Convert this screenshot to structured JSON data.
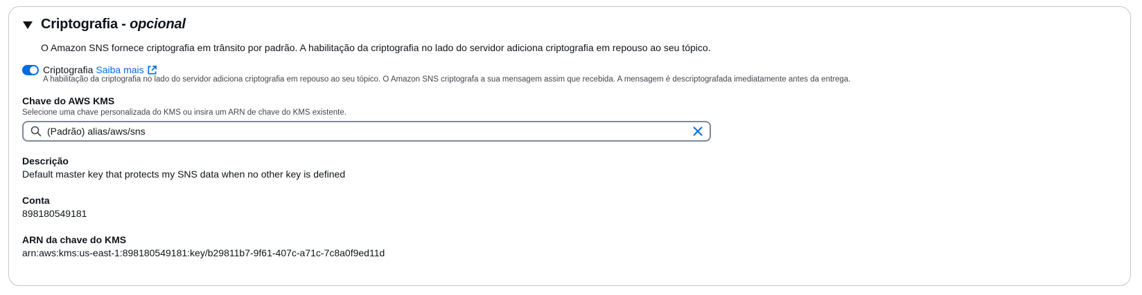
{
  "section": {
    "title": "Criptografia - ",
    "title_optional": "opcional",
    "description": "O Amazon SNS fornece criptografia em trânsito por padrão. A habilitação da criptografia no lado do servidor adiciona criptografia em repouso ao seu tópico."
  },
  "encryption_toggle": {
    "label": "Criptografia",
    "enabled": true,
    "learn_more": "Saiba mais",
    "description": "A habilitação da criptografia no lado do servidor adiciona criptografia em repouso ao seu tópico. O Amazon SNS criptografa a sua mensagem assim que recebida. A mensagem é descriptografada imediatamente antes da entrega."
  },
  "kms_key": {
    "label": "Chave do AWS KMS",
    "hint": "Selecione uma chave personalizada do KMS ou insira um ARN de chave do KMS existente.",
    "value": "(Padrão) alias/aws/sns"
  },
  "details": {
    "description_label": "Descrição",
    "description_value": "Default master key that protects my SNS data when no other key is defined",
    "account_label": "Conta",
    "account_value": "898180549181",
    "arn_label": "ARN da chave do KMS",
    "arn_value": "arn:aws:kms:us-east-1:898180549181:key/b29811b7-9f61-407c-a71c-7c8a0f9ed11d"
  },
  "colors": {
    "accent": "#006ce0",
    "border": "#c6c6cd",
    "input_border": "#7d8998"
  },
  "icons": {
    "caret": "caret-down-icon",
    "external": "external-link-icon",
    "search": "search-icon",
    "clear": "close-icon"
  }
}
